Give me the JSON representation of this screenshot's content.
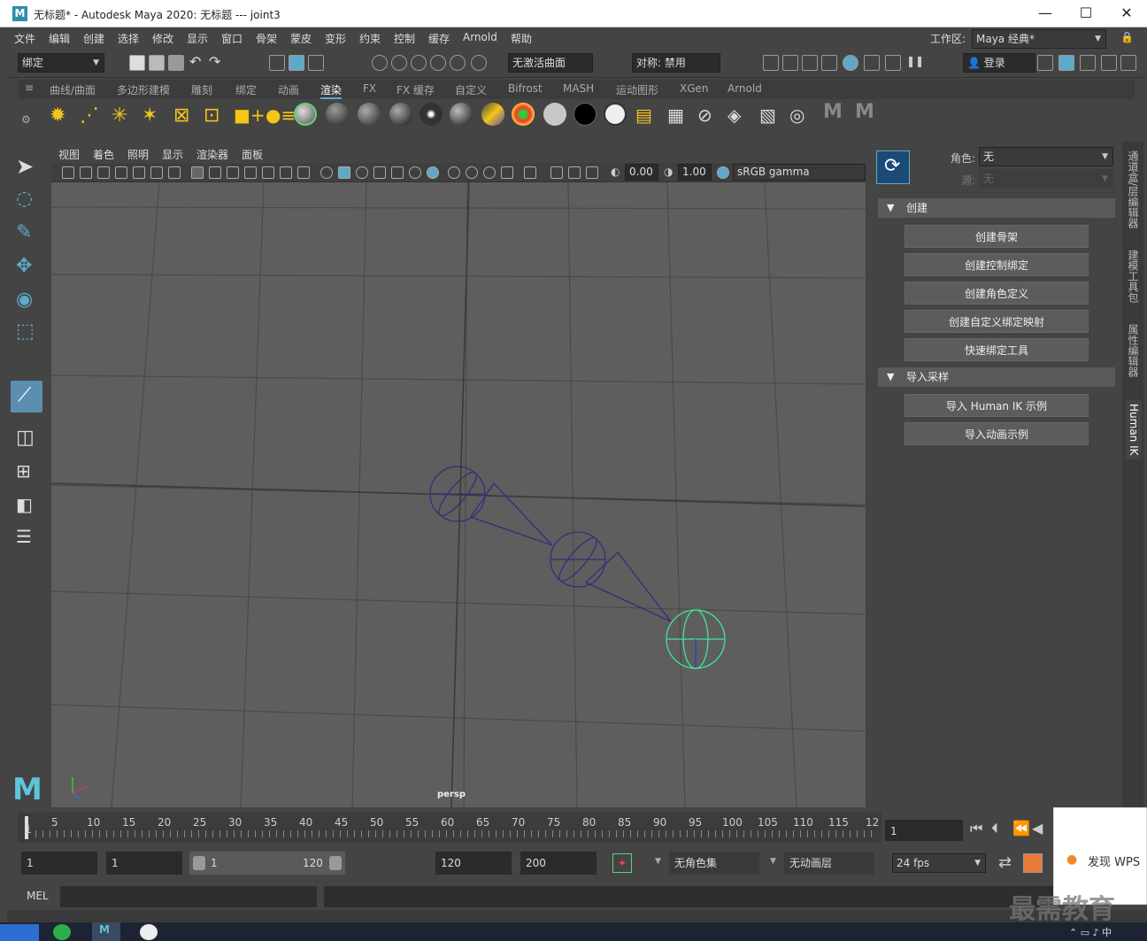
{
  "window": {
    "title": "无标题* - Autodesk Maya 2020: 无标题   ---   joint3",
    "logo": "M"
  },
  "menu": [
    "文件",
    "编辑",
    "创建",
    "选择",
    "修改",
    "显示",
    "窗口",
    "骨架",
    "蒙皮",
    "变形",
    "约束",
    "控制",
    "缓存",
    "Arnold",
    "帮助"
  ],
  "workspace": {
    "label": "工作区:",
    "value": "Maya 经典*"
  },
  "toolbar": {
    "mode_menu": "绑定",
    "live_surface": "无激活曲面",
    "symmetry": "对称: 禁用",
    "login": "登录"
  },
  "shelf_tabs": [
    "曲线/曲面",
    "多边形建模",
    "雕刻",
    "绑定",
    "动画",
    "渲染",
    "FX",
    "FX 缓存",
    "自定义",
    "Bifrost",
    "MASH",
    "运动图形",
    "XGen",
    "Arnold"
  ],
  "active_shelf_tab": "渲染",
  "viewport": {
    "menu": [
      "视图",
      "着色",
      "照明",
      "显示",
      "渲染器",
      "面板"
    ],
    "exposure": "0.00",
    "gamma": "1.00",
    "color_space": "sRGB gamma",
    "camera_label": "persp"
  },
  "human_ik": {
    "character_label": "角色:",
    "character_value": "无",
    "source_label": "源:",
    "source_value": "无",
    "section_create": "创建",
    "buttons_create": [
      "创建骨架",
      "创建控制绑定",
      "创建角色定义",
      "创建自定义绑定映射",
      "快速绑定工具"
    ],
    "section_import": "导入采样",
    "buttons_import": [
      "导入 Human IK 示例",
      "导入动画示例"
    ]
  },
  "side_tabs": [
    "通道盒/层编辑器",
    "建模工具包",
    "属性编辑器",
    "Human IK"
  ],
  "timeline": {
    "ticks": [
      "1",
      "5",
      "10",
      "15",
      "20",
      "25",
      "30",
      "35",
      "40",
      "45",
      "50",
      "55",
      "60",
      "65",
      "70",
      "75",
      "80",
      "85",
      "90",
      "95",
      "100",
      "105",
      "110",
      "115",
      "12"
    ],
    "current_frame": "1"
  },
  "range": {
    "start": "1",
    "playback_start": "1",
    "slider_start": "1",
    "slider_end": "120",
    "playback_end": "120",
    "end": "200",
    "char_set": "无角色集",
    "anim_layer": "无动画层",
    "fps": "24 fps"
  },
  "mel": {
    "label": "MEL"
  },
  "wps": {
    "text": "发现 WPS"
  },
  "watermark": "最需教育",
  "colors": {
    "accent": "#5fa8c8",
    "joint": "#3c2a78",
    "selected_joint": "#41e69a",
    "active_tab_text": "#ffffff"
  }
}
